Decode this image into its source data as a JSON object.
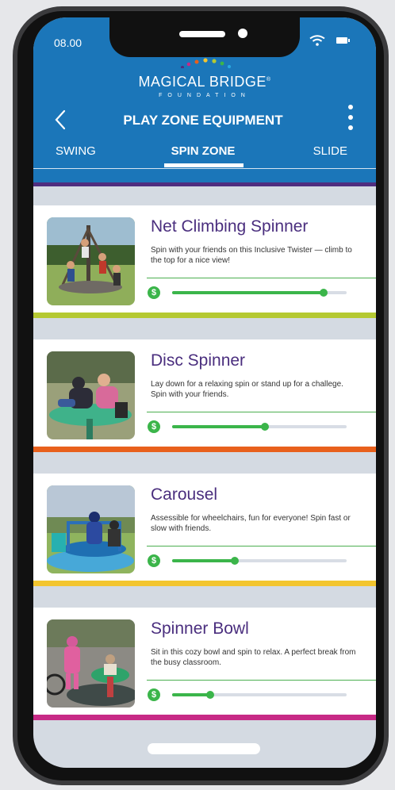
{
  "status_bar": {
    "time": "08.00"
  },
  "brand": {
    "name": "MAGICAL BRIDGE",
    "trademark": "®",
    "sub": "FOUNDATION"
  },
  "header": {
    "title": "PLAY ZONE EQUIPMENT",
    "back_icon": "chevron-left-icon",
    "menu_icon": "more-vertical-icon"
  },
  "tabs": [
    {
      "label": "SWING",
      "active": false
    },
    {
      "label": "SPIN ZONE",
      "active": true
    },
    {
      "label": "SLIDE",
      "active": false
    }
  ],
  "cost_symbol": "$",
  "cards": [
    {
      "name": "Net Climbing Spinner",
      "description": "Spin with your friends on this Inclusive Twister — climb to the top for a nice view!",
      "cost_level": 0.87,
      "accent": "#b5c932"
    },
    {
      "name": "Disc Spinner",
      "description": "Lay down for a relaxing spin or stand up for a challege. Spin with your friends.",
      "cost_level": 0.53,
      "accent": "#e8601c"
    },
    {
      "name": "Carousel",
      "description": "Assessible for wheelchairs, fun for everyone! Spin fast or slow with friends.",
      "cost_level": 0.36,
      "accent": "#f3c52f"
    },
    {
      "name": "Spinner Bowl",
      "description": "Sit in this cozy bowl and spin to relax. A perfect break from the busy classroom.",
      "cost_level": 0.22,
      "accent": "#c72a86"
    }
  ],
  "colors": {
    "header": "#1b76b9",
    "brand_purple": "#4f2d7f",
    "card_title": "#4a2e7e",
    "cost_green": "#3bb54a",
    "background": "#d4dae2"
  }
}
